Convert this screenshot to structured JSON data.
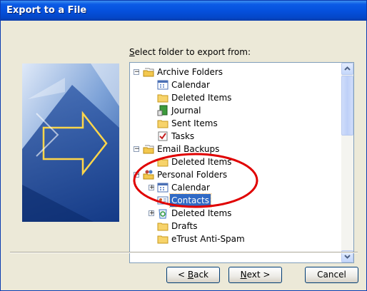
{
  "window": {
    "title": "Export to a File"
  },
  "folder_list": {
    "label_accel": "S",
    "label_rest": "elect folder to export from:",
    "items": [
      {
        "label": "Archive Folders",
        "icon": "folder-stack-icon"
      },
      {
        "label": "Calendar",
        "icon": "calendar-icon"
      },
      {
        "label": "Deleted Items",
        "icon": "folder-icon"
      },
      {
        "label": "Journal",
        "icon": "journal-icon"
      },
      {
        "label": "Sent Items",
        "icon": "folder-icon"
      },
      {
        "label": "Tasks",
        "icon": "tasks-icon"
      },
      {
        "label": "Email Backups",
        "icon": "folder-stack-icon"
      },
      {
        "label": "Deleted Items",
        "icon": "folder-icon"
      },
      {
        "label": "Personal Folders",
        "icon": "personal-folders-icon"
      },
      {
        "label": "Calendar",
        "icon": "calendar-icon"
      },
      {
        "label": "Contacts",
        "icon": "contacts-icon",
        "selected": true
      },
      {
        "label": "Deleted Items",
        "icon": "recycle-folder-icon"
      },
      {
        "label": "Drafts",
        "icon": "folder-icon"
      },
      {
        "label": "eTrust Anti-Spam",
        "icon": "folder-icon"
      }
    ]
  },
  "buttons": {
    "back_prefix": "< ",
    "back_accel": "B",
    "back_rest": "ack",
    "next_accel": "N",
    "next_rest": "ext >",
    "cancel": "Cancel"
  },
  "annotation": {
    "color": "#e00000"
  }
}
